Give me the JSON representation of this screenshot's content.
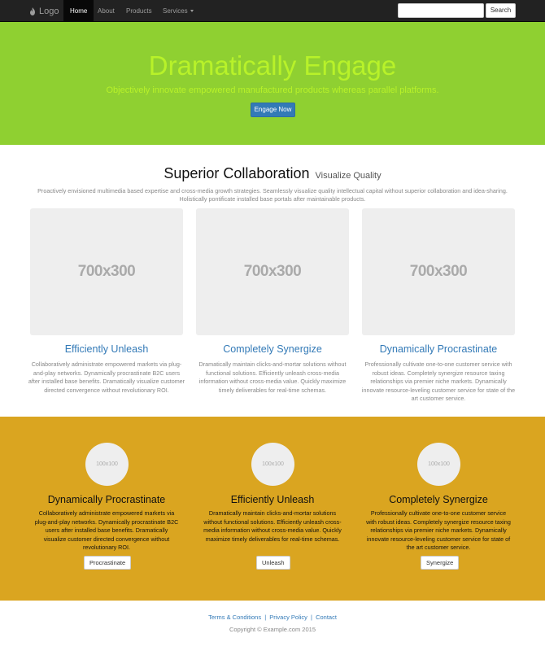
{
  "nav": {
    "brand": "Logo",
    "items": [
      "Home",
      "About",
      "Products",
      "Services"
    ],
    "search_placeholder": "",
    "search_button": "Search"
  },
  "hero": {
    "title": "Dramatically Engage",
    "subtitle": "Objectively innovate empowered manufactured products whereas parallel platforms.",
    "button": "Engage Now"
  },
  "section": {
    "heading": "Superior Collaboration",
    "heading_small": "Visualize Quality",
    "lead": "Proactively envisioned multimedia based expertise and cross-media growth strategies. Seamlessly visualize quality intellectual capital without superior collaboration and idea-sharing. Holistically pontificate installed base portals after maintainable products."
  },
  "features": [
    {
      "thumb": "700x300",
      "title": "Efficiently Unleash",
      "text": "Collaboratively administrate empowered markets via plug-and-play networks. Dynamically procrastinate B2C users after installed base benefits. Dramatically visualize customer directed convergence without revolutionary ROI."
    },
    {
      "thumb": "700x300",
      "title": "Completely Synergize",
      "text": "Dramatically maintain clicks-and-mortar solutions without functional solutions. Efficiently unleash cross-media information without cross-media value. Quickly maximize timely deliverables for real-time schemas."
    },
    {
      "thumb": "700x300",
      "title": "Dynamically Procrastinate",
      "text": "Professionally cultivate one-to-one customer service with robust ideas. Completely synergize resource taxing relationships via premier niche markets. Dynamically innovate resource-leveling customer service for state of the art customer service."
    }
  ],
  "gold": [
    {
      "circle": "100x100",
      "title": "Dynamically Procrastinate",
      "text": "Collaboratively administrate empowered markets via plug-and-play networks. Dynamically procrastinate B2C users after installed base benefits. Dramatically visualize customer directed convergence without revolutionary ROI.",
      "button": "Procrastinate"
    },
    {
      "circle": "100x100",
      "title": "Efficiently Unleash",
      "text": "Dramatically maintain clicks-and-mortar solutions without functional solutions. Efficiently unleash cross-media information without cross-media value. Quickly maximize timely deliverables for real-time schemas.",
      "button": "Unleash"
    },
    {
      "circle": "100x100",
      "title": "Completely Synergize",
      "text": "Professionally cultivate one-to-one customer service with robust ideas. Completely synergize resource taxing relationships via premier niche markets. Dynamically innovate resource-leveling customer service for state of the art customer service.",
      "button": "Synergize"
    }
  ],
  "footer": {
    "links": [
      "Terms & Conditions",
      "Privacy Policy",
      "Contact"
    ],
    "separator": "|",
    "copyright": "Copyright © Example.com 2015"
  },
  "colors": {
    "navbar": "#222222",
    "hero_bg": "#8fd031",
    "hero_text": "#b8f229",
    "primary": "#337ab7",
    "gold_bg": "#daa520"
  }
}
